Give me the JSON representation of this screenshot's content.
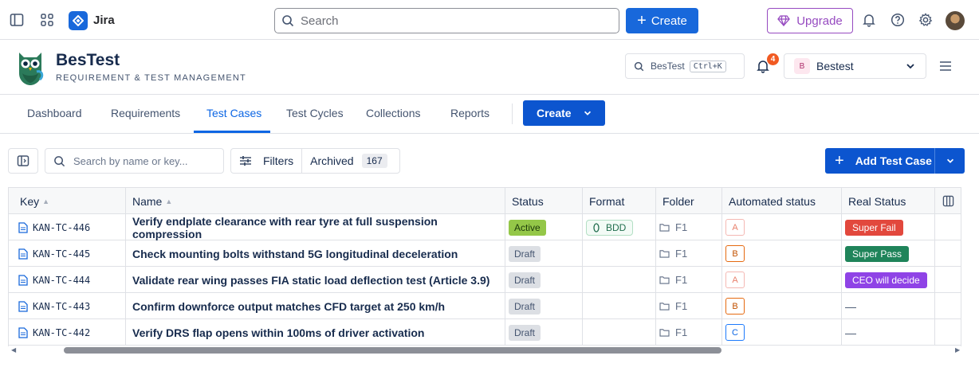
{
  "topbar": {
    "product": "Jira",
    "search_placeholder": "Search",
    "create_label": "Create",
    "upgrade_label": "Upgrade"
  },
  "app": {
    "title": "BesTest",
    "subtitle": "REQUIREMENT & TEST MANAGEMENT",
    "search_label": "BesTest",
    "shortcut": "Ctrl+K",
    "notification_count": "4",
    "workspace_initial": "B",
    "workspace_name": "Bestest"
  },
  "tabs": [
    "Dashboard",
    "Requirements",
    "Test Cases",
    "Test Cycles",
    "Collections",
    "Reports"
  ],
  "active_tab": "Test Cases",
  "create_label": "Create",
  "toolbar": {
    "search_placeholder": "Search by name or key...",
    "filters_label": "Filters",
    "archived_label": "Archived",
    "archived_count": "167",
    "add_label": "Add Test Case"
  },
  "columns": [
    "Key",
    "Name",
    "Status",
    "Format",
    "Folder",
    "Automated status",
    "Real Status"
  ],
  "rows": [
    {
      "key": "KAN-TC-446",
      "name": "Verify endplate clearance with rear tyre at full suspension compression",
      "status": "Active",
      "format": "BDD",
      "folder": "F1",
      "auto": "A",
      "real": "Super Fail",
      "real_color": "#e2483d"
    },
    {
      "key": "KAN-TC-445",
      "name": "Check mounting bolts withstand 5G longitudinal deceleration",
      "status": "Draft",
      "format": "",
      "folder": "F1",
      "auto": "B",
      "real": "Super Pass",
      "real_color": "#1f845a"
    },
    {
      "key": "KAN-TC-444",
      "name": "Validate rear wing passes FIA static load deflection test (Article 3.9)",
      "status": "Draft",
      "format": "",
      "folder": "F1",
      "auto": "A",
      "real": "CEO will decide",
      "real_color": "#8f43e6"
    },
    {
      "key": "KAN-TC-443",
      "name": "Confirm downforce output matches CFD target at 250 km/h",
      "status": "Draft",
      "format": "",
      "folder": "F1",
      "auto": "B",
      "real": "—",
      "real_color": ""
    },
    {
      "key": "KAN-TC-442",
      "name": "Verify DRS flap opens within 100ms of driver activation",
      "status": "Draft",
      "format": "",
      "folder": "F1",
      "auto": "C",
      "real": "—",
      "real_color": ""
    }
  ]
}
